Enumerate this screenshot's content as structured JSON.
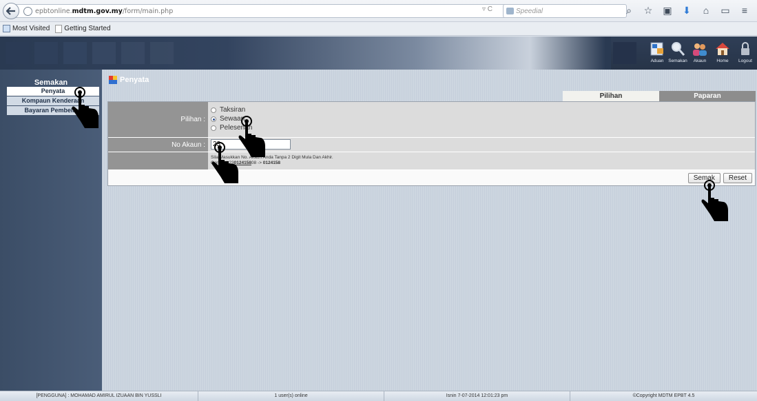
{
  "browser": {
    "url_prefix": "epbtonline.",
    "url_domain": "mdtm.gov.my",
    "url_path": "/form/main.php",
    "search_placeholder": "Speedial",
    "bookmarks": [
      "Most Visited",
      "Getting Started"
    ]
  },
  "top_menu": [
    {
      "label": "Aduan",
      "icon": "complaint-icon"
    },
    {
      "label": "Semakan",
      "icon": "magnifier-icon"
    },
    {
      "label": "Akaun",
      "icon": "users-icon"
    },
    {
      "label": "Home",
      "icon": "home-icon"
    },
    {
      "label": "Logout",
      "icon": "lock-icon"
    }
  ],
  "sidebar": {
    "title": "Semakan",
    "items": [
      "Penyata",
      "Kompaun Kenderaan",
      "Bayaran Pembelian"
    ]
  },
  "page": {
    "title": "Penyata",
    "tabs": [
      "Pilihan",
      "Paparan"
    ]
  },
  "form": {
    "pilihan_label": "Pilihan :",
    "options": [
      "Taksiran",
      "Sewaan",
      "Pelesenan"
    ],
    "selected_option": "Sewaan",
    "account_label": "No Akaun :",
    "account_value": "23",
    "hint_line1": "Sila Masukkan No. Akaun Anda Tanpa 2 Digit Mula Dan Akhir.",
    "hint_line2_prefix": "Contoh : 23",
    "hint_line2_mid": "0124158",
    "hint_line2_suffix": "08 -> ",
    "hint_line2_result": "0124158",
    "submit_label": "Semak",
    "reset_label": "Reset"
  },
  "status": {
    "user": "[PENGGUNA] : MOHAMAD AMIRUL IZUAAN BIN YUSSLI",
    "online": "1 user(s) online",
    "datetime": "Isnin 7-07-2014 12:01:23 pm",
    "copyright": "©Copyright MDTM EPBT 4.5"
  }
}
